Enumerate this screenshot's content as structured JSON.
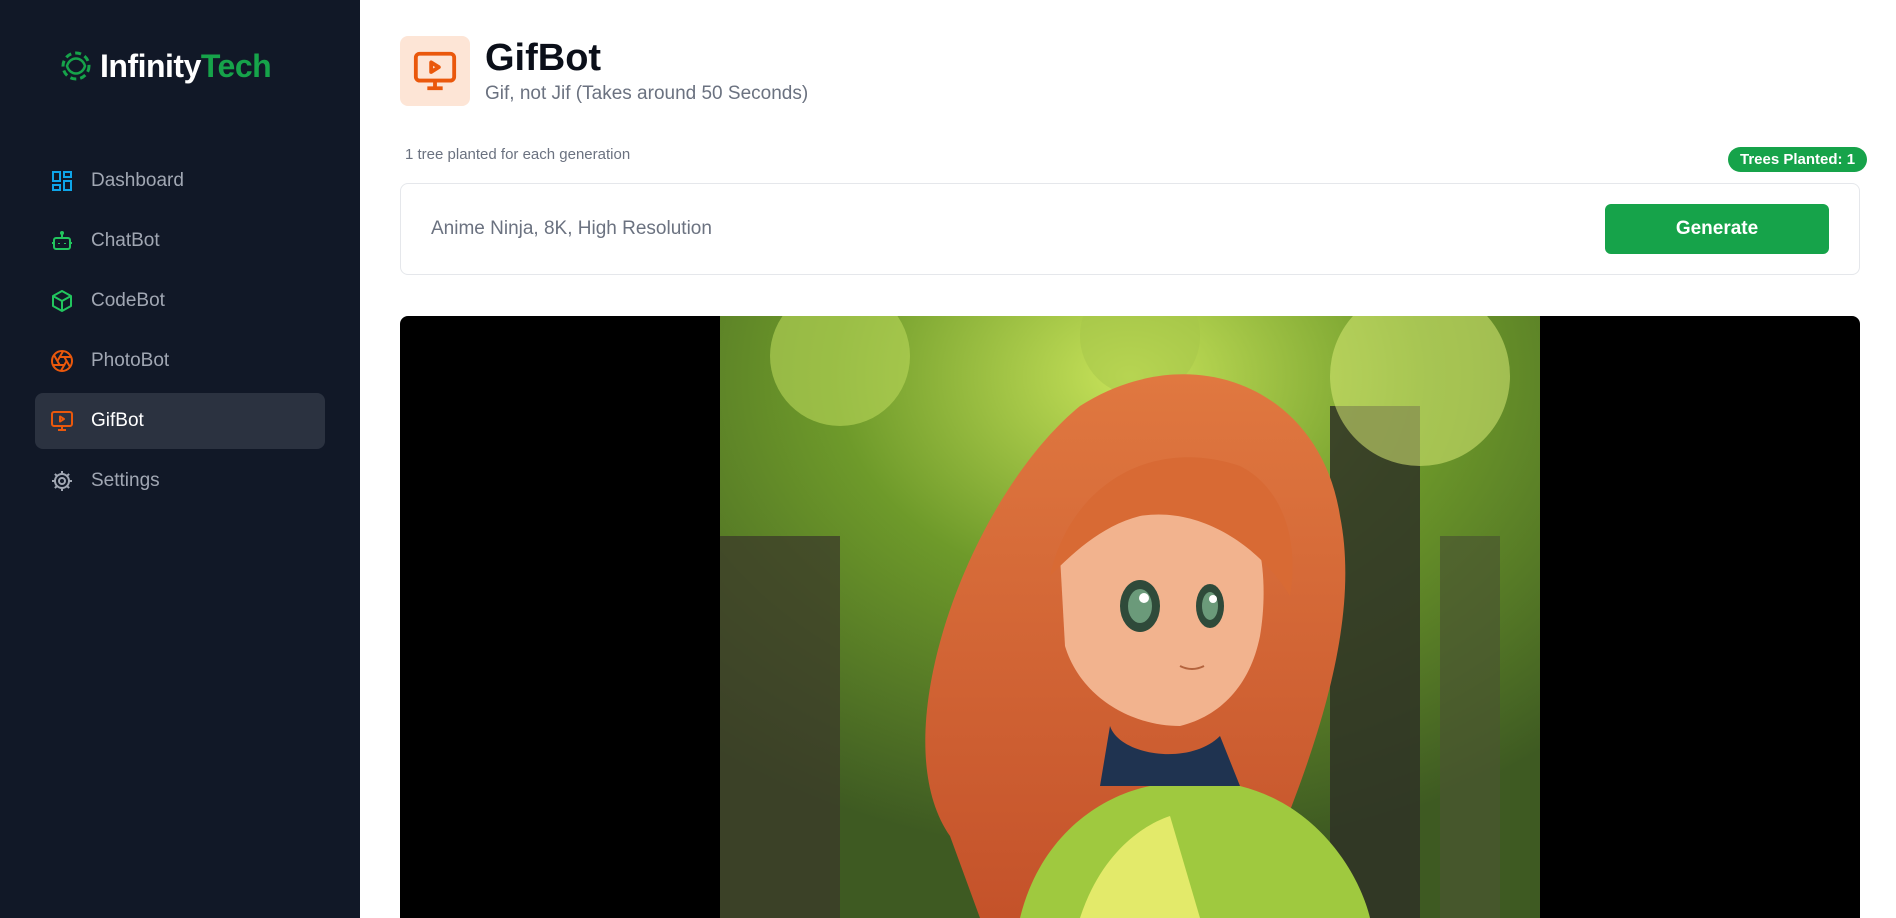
{
  "brand": {
    "name_primary": "Infinity",
    "name_accent": "Tech"
  },
  "sidebar": {
    "items": [
      {
        "label": "Dashboard",
        "icon": "dashboard-icon",
        "color": "#0ea5e9"
      },
      {
        "label": "ChatBot",
        "icon": "bot-icon",
        "color": "#22c55e"
      },
      {
        "label": "CodeBot",
        "icon": "cube-icon",
        "color": "#22c55e"
      },
      {
        "label": "PhotoBot",
        "icon": "aperture-icon",
        "color": "#ea580c"
      },
      {
        "label": "GifBot",
        "icon": "monitor-play-icon",
        "color": "#ea580c",
        "active": true
      },
      {
        "label": "Settings",
        "icon": "gear-icon",
        "color": "#a1a7b3"
      }
    ]
  },
  "header": {
    "title": "GifBot",
    "subtitle": "Gif, not Jif (Takes around 50 Seconds)",
    "icon": "monitor-play-icon",
    "icon_color": "#ea580c"
  },
  "generation": {
    "note": "1 tree planted for each generation",
    "trees_badge": "Trees Planted: 1",
    "prompt_placeholder": "Anime Ninja, 8K, High Resolution",
    "prompt_value": "",
    "generate_label": "Generate"
  },
  "colors": {
    "accent_green": "#16a34a",
    "sidebar_bg": "#111827",
    "active_item_bg": "#2b3240"
  }
}
